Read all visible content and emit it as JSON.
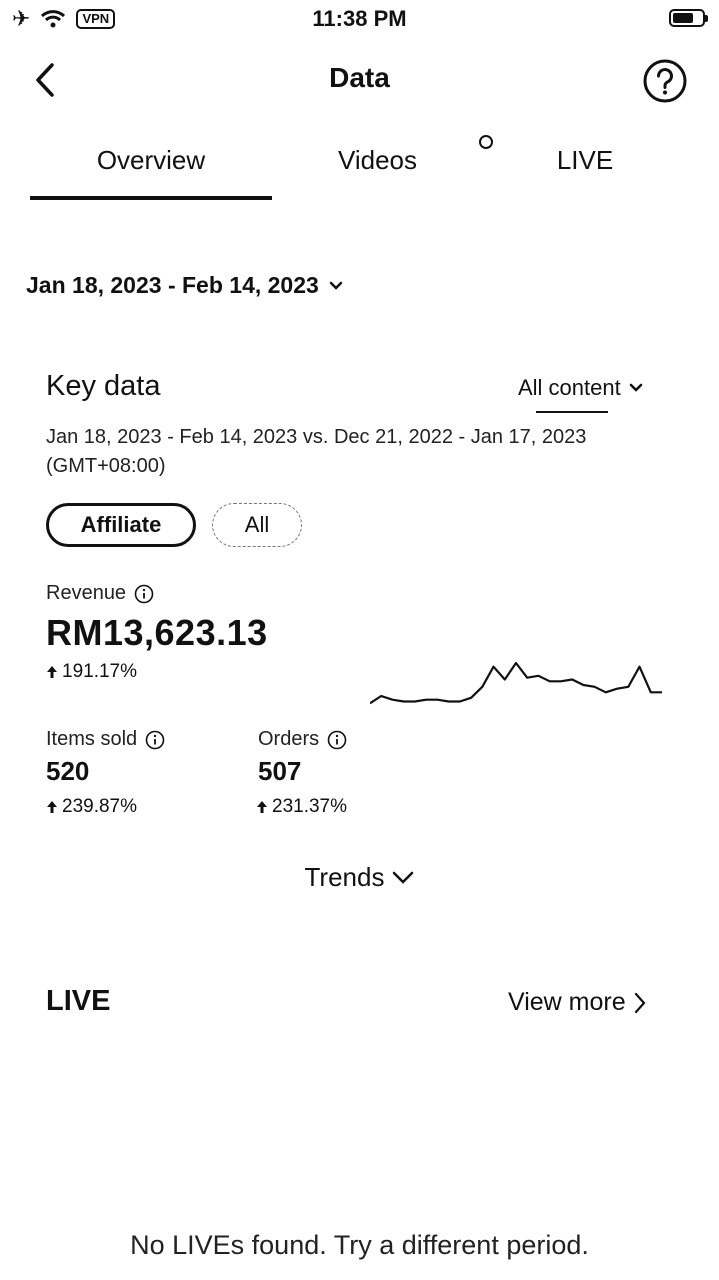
{
  "status_bar": {
    "time": "11:38 PM",
    "vpn_label": "VPN"
  },
  "header": {
    "title": "Data"
  },
  "tabs": [
    {
      "label": "Overview",
      "active": true
    },
    {
      "label": "Videos",
      "active": false
    },
    {
      "label": "LIVE",
      "active": false
    }
  ],
  "date_range": "Jan 18, 2023 - Feb 14, 2023",
  "key_data": {
    "title": "Key data",
    "filter": "All content",
    "period_line1": "Jan 18, 2023 - Feb 14, 2023 vs. Dec 21, 2022 - Jan 17, 2023",
    "period_line2": "(GMT+08:00)",
    "chips": [
      "Affiliate",
      "All"
    ],
    "revenue": {
      "label": "Revenue",
      "value": "RM13,623.13",
      "change": "191.17%"
    },
    "items_sold": {
      "label": "Items sold",
      "value": "520",
      "change": "239.87%"
    },
    "orders": {
      "label": "Orders",
      "value": "507",
      "change": "231.37%"
    },
    "trends_label": "Trends"
  },
  "live": {
    "title": "LIVE",
    "view_more": "View more",
    "empty_message": "No LIVEs found. Try a different period."
  },
  "chart_data": {
    "type": "line",
    "series": [
      {
        "values": [
          2,
          6,
          4,
          3,
          3,
          4,
          4,
          3,
          3,
          5,
          11,
          22,
          15,
          24,
          16,
          17,
          14,
          14,
          15,
          12,
          11,
          8,
          10,
          11,
          22,
          8,
          8
        ]
      }
    ]
  }
}
